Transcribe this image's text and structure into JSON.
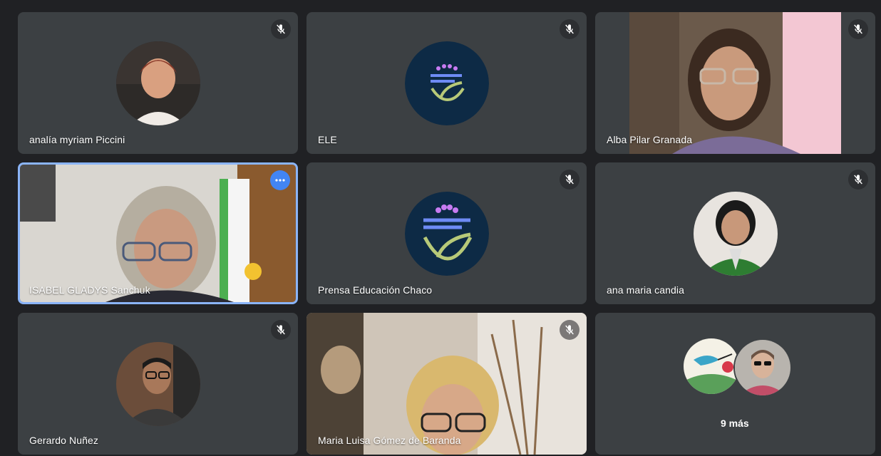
{
  "participants": [
    {
      "name": "analía myriam Piccini",
      "muted": true,
      "avatar": "woman-red-hair-photo"
    },
    {
      "name": "ELE",
      "muted": true,
      "avatar": "education-chaco-logo"
    },
    {
      "name": "Alba Pilar Granada",
      "muted": true,
      "avatar": "camera-video"
    },
    {
      "name": "ISABEL GLADYS Sanchuk",
      "muted": false,
      "avatar": "camera-video"
    },
    {
      "name": "Prensa Educación Chaco",
      "muted": true,
      "avatar": "education-chaco-logo"
    },
    {
      "name": "ana maria candia",
      "muted": true,
      "avatar": "woman-green-jacket-photo"
    },
    {
      "name": "Gerardo Nuñez",
      "muted": true,
      "avatar": "man-glasses-photo"
    },
    {
      "name": "Maria Luisa Gómez de Baranda",
      "muted": true,
      "avatar": "camera-video"
    }
  ],
  "overflow_tile": {
    "label": "9 más"
  },
  "icons": {
    "mute": "mic-off-icon",
    "more": "more-options-icon"
  },
  "colors": {
    "background": "#202124",
    "tile": "#3c4043",
    "active_border": "#8ab4f8",
    "logo_bg": "#0d2a45"
  }
}
